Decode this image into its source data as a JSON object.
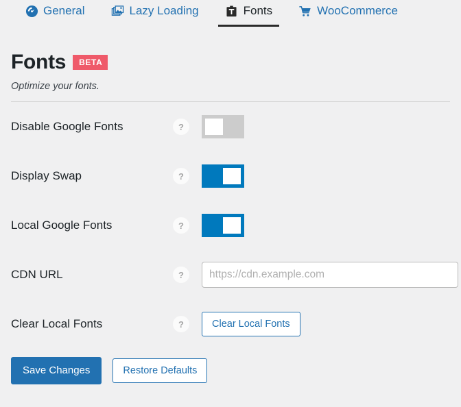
{
  "colors": {
    "background": "#f0f0f1",
    "link_blue": "#2271b1",
    "toggle_on": "#0079bd",
    "toggle_off": "#cccccc",
    "beta_badge": "#ef5a6a",
    "active_tab_underline": "#2a2a2a",
    "text": "#1d2327"
  },
  "tabs": [
    {
      "label": "General",
      "icon": "dashboard-gauge-icon",
      "active": false
    },
    {
      "label": "Lazy Loading",
      "icon": "stacked-images-icon",
      "active": false
    },
    {
      "label": "Fonts",
      "icon": "font-clipboard-icon",
      "active": true
    },
    {
      "label": "WooCommerce",
      "icon": "shopping-cart-icon",
      "active": false
    }
  ],
  "header": {
    "title": "Fonts",
    "badge": "BETA",
    "subtitle": "Optimize your fonts."
  },
  "help_icon": "?",
  "rows": [
    {
      "label": "Disable Google Fonts",
      "control": "toggle",
      "state": "off"
    },
    {
      "label": "Display Swap",
      "control": "toggle",
      "state": "on"
    },
    {
      "label": "Local Google Fonts",
      "control": "toggle",
      "state": "on"
    },
    {
      "label": "CDN URL",
      "control": "text",
      "value": "",
      "placeholder": "https://cdn.example.com"
    },
    {
      "label": "Clear Local Fonts",
      "control": "button",
      "button_label": "Clear Local Fonts"
    }
  ],
  "actions": {
    "save_label": "Save Changes",
    "restore_label": "Restore Defaults"
  }
}
